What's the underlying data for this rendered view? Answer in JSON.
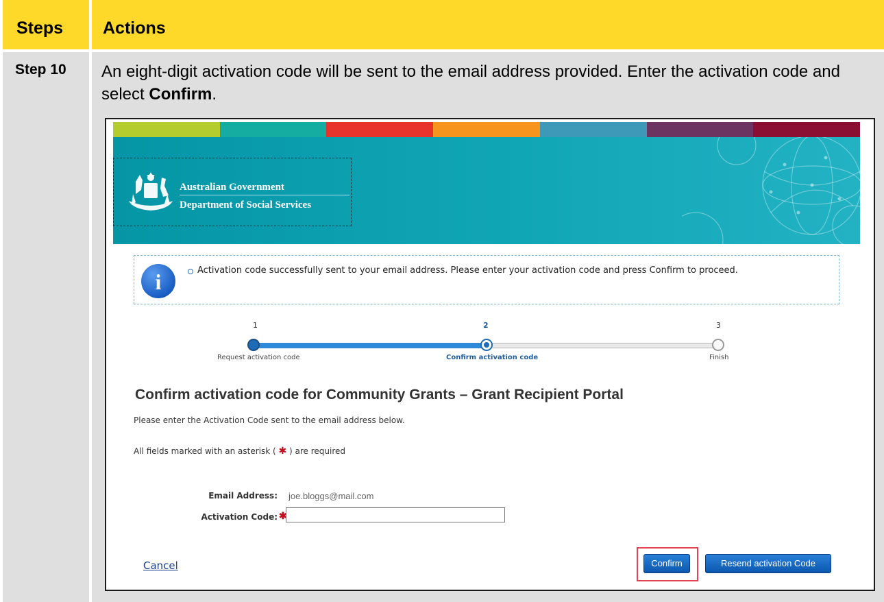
{
  "header": {
    "steps_label": "Steps",
    "actions_label": "Actions"
  },
  "step": {
    "label": "Step 10",
    "text_before": "An eight-digit activation code will be sent to the email address provided. Enter the activation code and select ",
    "text_bold": "Confirm",
    "text_after": "."
  },
  "screenshot": {
    "stripe_colors": [
      "#b5cc2e",
      "#15ada2",
      "#e8322c",
      "#f7941d",
      "#3d99b7",
      "#6b3461",
      "#8b0e33"
    ],
    "logo": {
      "line1": "Australian Government",
      "line2": "Department of Social Services"
    },
    "info_message": "Activation code successfully sent to your email address. Please enter your activation code and press Confirm to proceed.",
    "info_icon": "info-icon",
    "progress": {
      "current_step": 2,
      "steps": [
        {
          "number": "1",
          "label": "Request activation code"
        },
        {
          "number": "2",
          "label": "Confirm activation code"
        },
        {
          "number": "3",
          "label": "Finish"
        }
      ]
    },
    "title": "Confirm activation code for Community Grants – Grant Recipient Portal",
    "intro": "Please enter the Activation Code sent to the email address below.",
    "required_note": {
      "before": "All fields marked with an asterisk ( ",
      "star": "✱",
      "after": " ) are required"
    },
    "form": {
      "email_label": "Email Address:",
      "email_value": "joe.bloggs@mail.com",
      "code_label": "Activation Code:",
      "code_value": "",
      "required_star": "✱"
    },
    "actions": {
      "cancel": "Cancel",
      "confirm": "Confirm",
      "resend": "Resend activation Code"
    },
    "highlight_color": "#e2444f"
  }
}
